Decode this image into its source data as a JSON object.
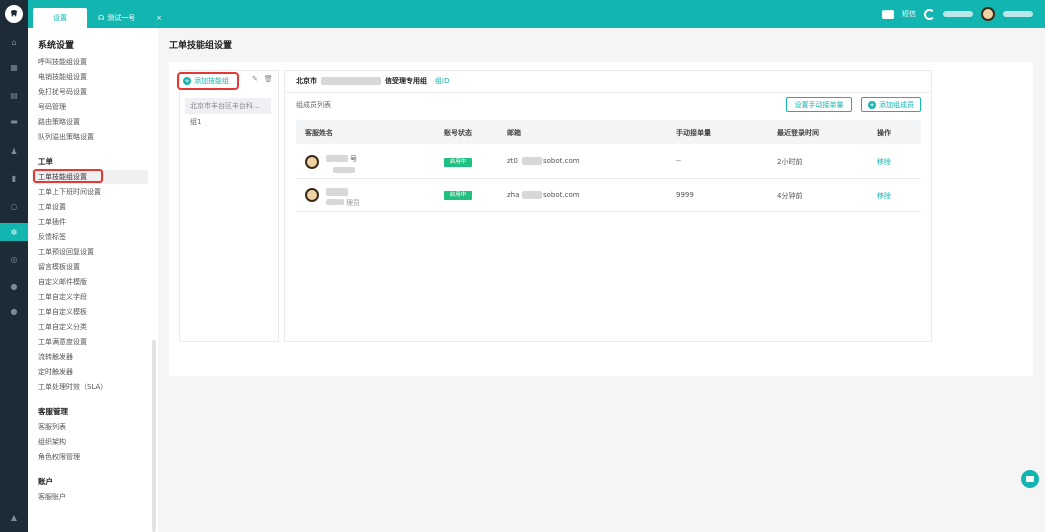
{
  "tabs": [
    {
      "label": "设置"
    },
    {
      "label": "测试一号"
    }
  ],
  "topbar": {
    "sms_label": "短信"
  },
  "nav": {
    "title": "系统设置",
    "group1": [
      "呼叫技能组设置",
      "电销技能组设置",
      "免打扰号码设置",
      "号码管理",
      "路由策略设置",
      "队列溢出策略设置"
    ],
    "section_ticket": "工单",
    "group2": [
      "工单技能组设置",
      "工单上下班时间设置",
      "工单设置",
      "工单插件",
      "反馈标签",
      "工单预设回复设置",
      "留言模板设置",
      "自定义邮件模版",
      "工单自定义字段",
      "工单自定义模板",
      "工单自定义分类",
      "工单满意度设置",
      "流转触发器",
      "定时触发器",
      "工单处理时效（SLA）"
    ],
    "section_agent": "客服管理",
    "group3": [
      "客服列表",
      "组织架构",
      "角色权限管理"
    ],
    "section_account": "账户",
    "group4": [
      "客服账户"
    ]
  },
  "page": {
    "title": "工单技能组设置"
  },
  "groups_panel": {
    "add_label": "添加技能组",
    "items": [
      "北京市丰台区丰台科...",
      "组1"
    ]
  },
  "group_detail": {
    "name_prefix": "北京市",
    "name_suffix": "信受理专用组",
    "id_label": "组ID",
    "members_label": "组成员列表",
    "btn_manual": "设置手动接单量",
    "btn_add_member": "添加组成员"
  },
  "table": {
    "headers": [
      "客服姓名",
      "账号状态",
      "邮箱",
      "手动接单量",
      "最近登录时间",
      "操作"
    ],
    "rows": [
      {
        "name_tail": "号",
        "status": "启用中",
        "email_start": "zt0",
        "email_end": "sobot.com",
        "manual": "--",
        "last_login": "2小时前",
        "action": "移除"
      },
      {
        "name_tail": "理员",
        "status": "启用中",
        "email_start": "zha",
        "email_end": "sobot.com",
        "manual": "9999",
        "last_login": "4分钟前",
        "action": "移除"
      }
    ]
  }
}
